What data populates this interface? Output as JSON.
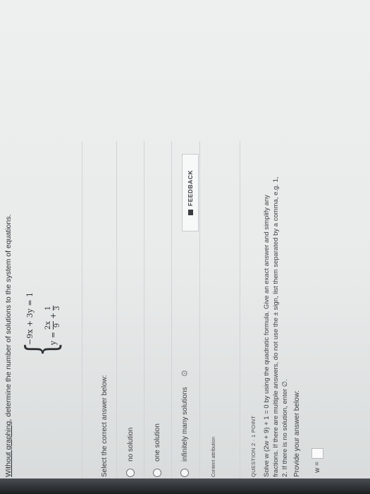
{
  "question1": {
    "prompt_pre": "Without graphing",
    "prompt_post": ", determine the number of solutions to the system of equations.",
    "equation1": "−9x + 3y = 1",
    "equation2_lhs": "y =",
    "equation2_frac1_num": "2x",
    "equation2_frac1_den": "9",
    "equation2_plus": "+",
    "equation2_frac2_num": "1",
    "equation2_frac2_den": "3",
    "select_prompt": "Select the correct answer below:",
    "options": [
      "no solution",
      "one solution",
      "infinitely many solutions"
    ],
    "feedback_label": "FEEDBACK",
    "content_attribution": "Content attribution"
  },
  "question2": {
    "header": "QUESTION 2 · 1 POINT",
    "text": "Solve w (2w + 9) + 1 = 0 by using the quadratic formula. Give an exact answer and simplify any fractions. If there are multiple answers, do not use the ± sign, list them separated by a comma, e.g. 1, 2. If there is no solution, enter ∅.",
    "provide_prompt": "Provide your answer below:",
    "answer_label": "w ="
  }
}
